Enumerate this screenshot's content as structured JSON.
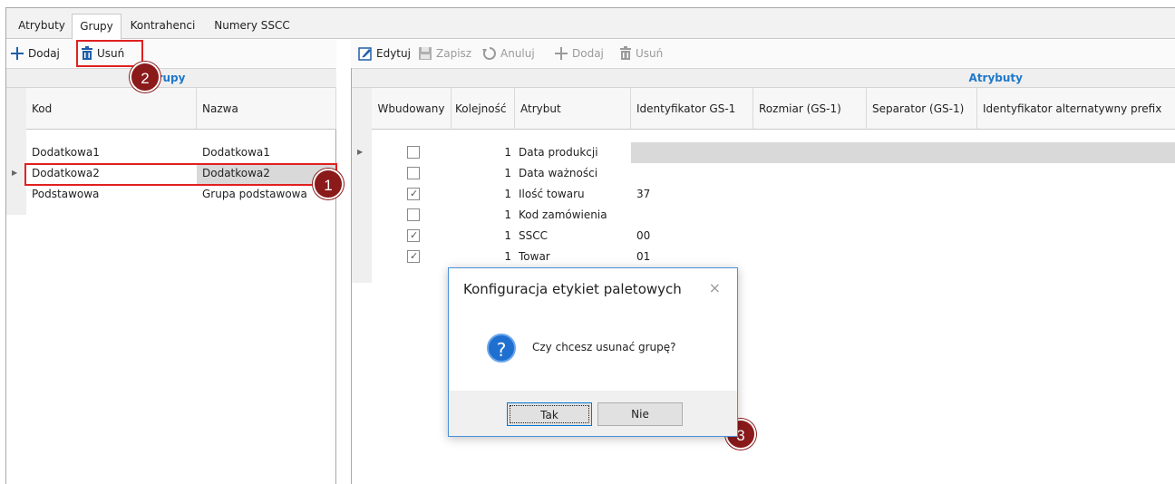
{
  "tabs": [
    {
      "label": "Atrybuty",
      "active": false
    },
    {
      "label": "Grupy",
      "active": true
    },
    {
      "label": "Kontrahenci",
      "active": false
    },
    {
      "label": "Numery SSCC",
      "active": false
    }
  ],
  "left_toolbar": {
    "add_label": "Dodaj",
    "delete_label": "Usuń"
  },
  "right_toolbar": {
    "edit_label": "Edytuj",
    "save_label": "Zapisz",
    "cancel_label": "Anuluj",
    "add_label": "Dodaj",
    "delete_label": "Usuń"
  },
  "groups_grid": {
    "band_title": "rupy",
    "columns": [
      "Kod",
      "Nazwa"
    ],
    "rows": [
      {
        "kod": "Dodatkowa1",
        "nazwa": "Dodatkowa1"
      },
      {
        "kod": "Dodatkowa2",
        "nazwa": "Dodatkowa2",
        "selected": true
      },
      {
        "kod": "Podstawowa",
        "nazwa": "Grupa podstawowa"
      }
    ]
  },
  "attributes_grid": {
    "band_title": "Atrybuty",
    "columns": [
      "Wbudowany",
      "Kolejność",
      "Atrybut",
      "Identyfikator GS-1",
      "Rozmiar (GS-1)",
      "Separator (GS-1)",
      "Identyfikator alternatywny prefix"
    ],
    "rows": [
      {
        "wbudowany": false,
        "kolejnosc": "1",
        "atrybut": "Data produkcji",
        "gs1": ""
      },
      {
        "wbudowany": false,
        "kolejnosc": "1",
        "atrybut": "Data ważności",
        "gs1": ""
      },
      {
        "wbudowany": true,
        "kolejnosc": "1",
        "atrybut": "Ilość towaru",
        "gs1": "37"
      },
      {
        "wbudowany": false,
        "kolejnosc": "1",
        "atrybut": "Kod zamówienia",
        "gs1": ""
      },
      {
        "wbudowany": true,
        "kolejnosc": "1",
        "atrybut": "SSCC",
        "gs1": "00"
      },
      {
        "wbudowany": true,
        "kolejnosc": "1",
        "atrybut": "Towar",
        "gs1": "01"
      }
    ]
  },
  "dialog": {
    "title": "Konfiguracja etykiet paletowych",
    "message": "Czy chcesz usunać grupę?",
    "yes_label": "Tak",
    "no_label": "Nie",
    "close_glyph": "×",
    "icon_glyph": "?"
  },
  "markers": [
    "1",
    "2",
    "3"
  ],
  "colors": {
    "accent": "#1f78c8",
    "highlight": "#e02020",
    "marker": "#8b1a1a",
    "question": "#1f6fd0"
  }
}
